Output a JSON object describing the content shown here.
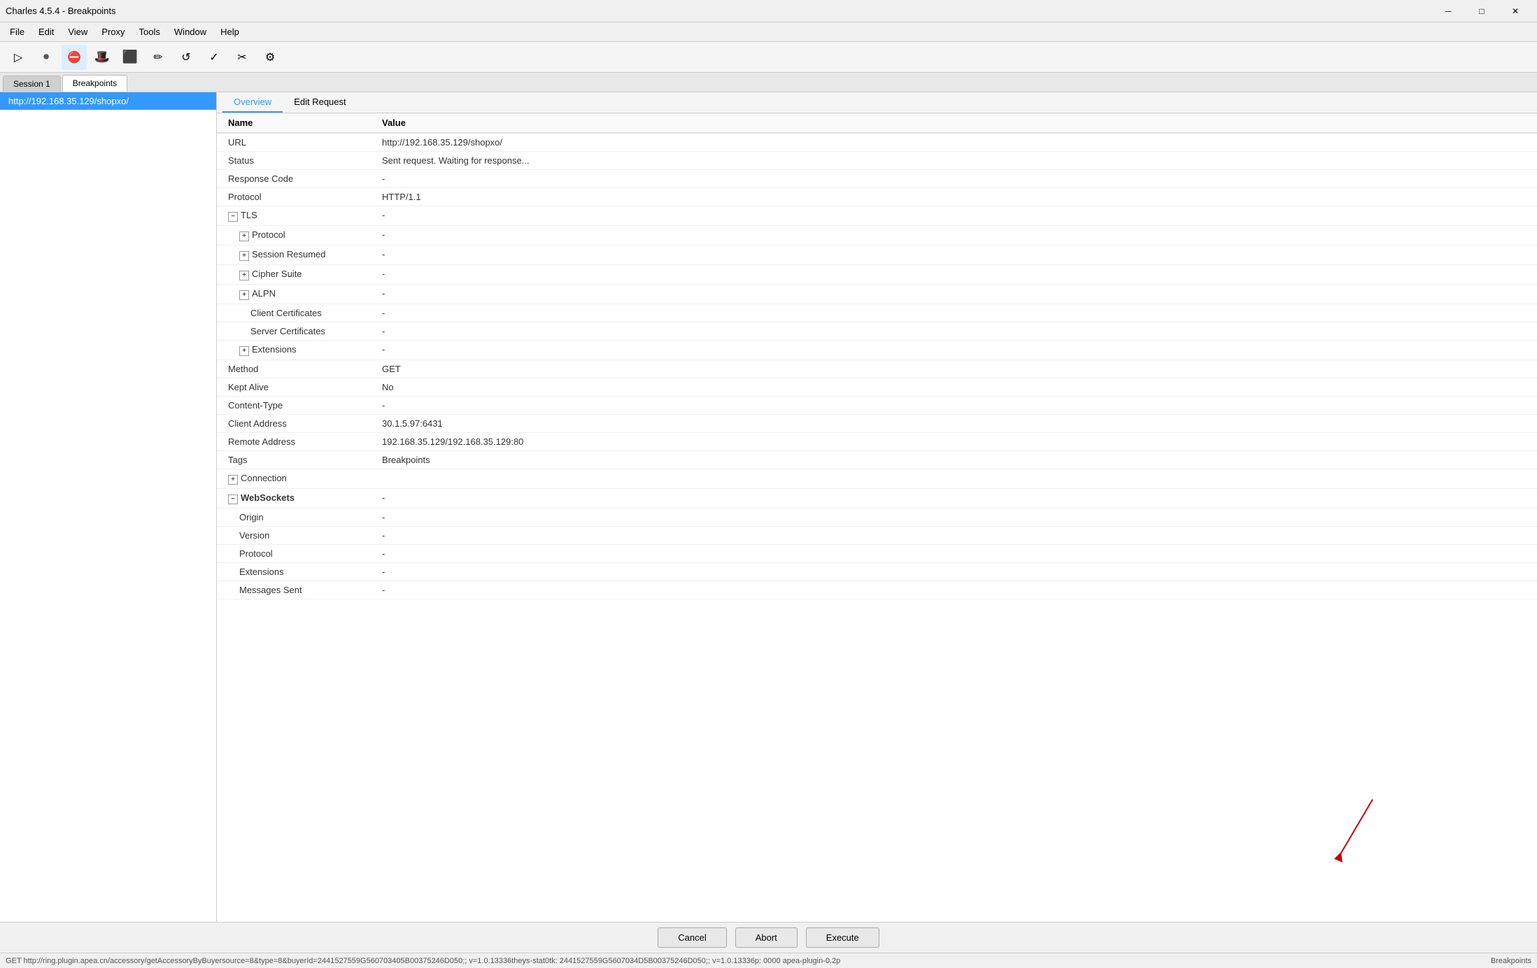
{
  "window": {
    "title": "Charles 4.5.4 - Breakpoints"
  },
  "title_controls": {
    "minimize": "─",
    "maximize": "□",
    "close": "✕"
  },
  "menu": {
    "items": [
      "File",
      "Edit",
      "View",
      "Proxy",
      "Tools",
      "Window",
      "Help"
    ]
  },
  "toolbar": {
    "buttons": [
      {
        "name": "session-icon",
        "icon": "▷",
        "tooltip": "Session"
      },
      {
        "name": "record-icon",
        "icon": "⏺",
        "tooltip": "Record"
      },
      {
        "name": "breakpoint-icon",
        "icon": "⛔",
        "tooltip": "Breakpoints"
      },
      {
        "name": "hat-icon",
        "icon": "🎩",
        "tooltip": "Charles"
      },
      {
        "name": "stop-icon",
        "icon": "🛑",
        "tooltip": "Stop"
      },
      {
        "name": "pencil-icon",
        "icon": "✏",
        "tooltip": "Edit"
      },
      {
        "name": "refresh-icon",
        "icon": "↺",
        "tooltip": "Refresh"
      },
      {
        "name": "check-icon",
        "icon": "✓",
        "tooltip": "Check"
      },
      {
        "name": "tools-icon",
        "icon": "✂",
        "tooltip": "Tools"
      },
      {
        "name": "settings-icon",
        "icon": "⚙",
        "tooltip": "Settings"
      }
    ]
  },
  "tabs": {
    "items": [
      {
        "label": "Session 1",
        "active": false
      },
      {
        "label": "Breakpoints",
        "active": true
      }
    ]
  },
  "sidebar": {
    "items": [
      {
        "label": "http://192.168.35.129/shopxo/",
        "selected": true
      }
    ]
  },
  "inner_tabs": [
    {
      "label": "Overview",
      "active": true
    },
    {
      "label": "Edit Request",
      "active": false
    }
  ],
  "columns": {
    "name": "Name",
    "value": "Value"
  },
  "overview_rows": [
    {
      "id": "url",
      "name": "URL",
      "value": "http://192.168.35.129/shopxo/",
      "indent": 0
    },
    {
      "id": "status",
      "name": "Status",
      "value": "Sent request. Waiting for response...",
      "indent": 0
    },
    {
      "id": "response-code",
      "name": "Response Code",
      "value": "-",
      "indent": 0
    },
    {
      "id": "protocol",
      "name": "Protocol",
      "value": "HTTP/1.1",
      "indent": 0
    },
    {
      "id": "tls",
      "name": "TLS",
      "value": "-",
      "indent": 0,
      "expandable": true,
      "expanded": true,
      "bold": false,
      "collapse": true
    },
    {
      "id": "tls-protocol",
      "name": "Protocol",
      "value": "-",
      "indent": 1,
      "expandable": true
    },
    {
      "id": "tls-session-resumed",
      "name": "Session Resumed",
      "value": "-",
      "indent": 1,
      "expandable": true
    },
    {
      "id": "tls-cipher-suite",
      "name": "Cipher Suite",
      "value": "-",
      "indent": 1,
      "expandable": true
    },
    {
      "id": "tls-alpn",
      "name": "ALPN",
      "value": "-",
      "indent": 1,
      "expandable": true
    },
    {
      "id": "tls-client-certs",
      "name": "Client Certificates",
      "value": "-",
      "indent": 2
    },
    {
      "id": "tls-server-certs",
      "name": "Server Certificates",
      "value": "-",
      "indent": 2
    },
    {
      "id": "tls-extensions",
      "name": "Extensions",
      "value": "-",
      "indent": 1,
      "expandable": true
    },
    {
      "id": "method",
      "name": "Method",
      "value": "GET",
      "indent": 0
    },
    {
      "id": "kept-alive",
      "name": "Kept Alive",
      "value": "No",
      "indent": 0
    },
    {
      "id": "content-type",
      "name": "Content-Type",
      "value": "-",
      "indent": 0
    },
    {
      "id": "client-address",
      "name": "Client Address",
      "value": "30.1.5.97:6431",
      "indent": 0
    },
    {
      "id": "remote-address",
      "name": "Remote Address",
      "value": "192.168.35.129/192.168.35.129:80",
      "indent": 0
    },
    {
      "id": "tags",
      "name": "Tags",
      "value": "Breakpoints",
      "indent": 0
    },
    {
      "id": "connection",
      "name": "Connection",
      "value": "",
      "indent": 0,
      "expandable": true,
      "bold": false
    },
    {
      "id": "websockets",
      "name": "WebSockets",
      "value": "-",
      "indent": 0,
      "expanded": true,
      "collapse": true,
      "bold": true
    },
    {
      "id": "ws-origin",
      "name": "Origin",
      "value": "-",
      "indent": 1
    },
    {
      "id": "ws-version",
      "name": "Version",
      "value": "-",
      "indent": 1
    },
    {
      "id": "ws-protocol",
      "name": "Protocol",
      "value": "-",
      "indent": 1
    },
    {
      "id": "ws-extensions",
      "name": "Extensions",
      "value": "-",
      "indent": 1
    },
    {
      "id": "ws-messages-sent",
      "name": "Messages Sent",
      "value": "-",
      "indent": 1
    }
  ],
  "action_buttons": {
    "cancel": "Cancel",
    "abort": "Abort",
    "execute": "Execute"
  },
  "status_bar": {
    "left": "GET http://ring.plugin.apea.cn/accessory/getAccessoryByBuyersource=8&type=8&buyerId=2441527559G560703405B00375246D050;; v=1.0.13336theys-stat0tk: 2441527559G5607034D5B00375246D050;; v=1.0.13336p: 0000 apea-plugin-0.2p",
    "right": "Breakpoints"
  }
}
